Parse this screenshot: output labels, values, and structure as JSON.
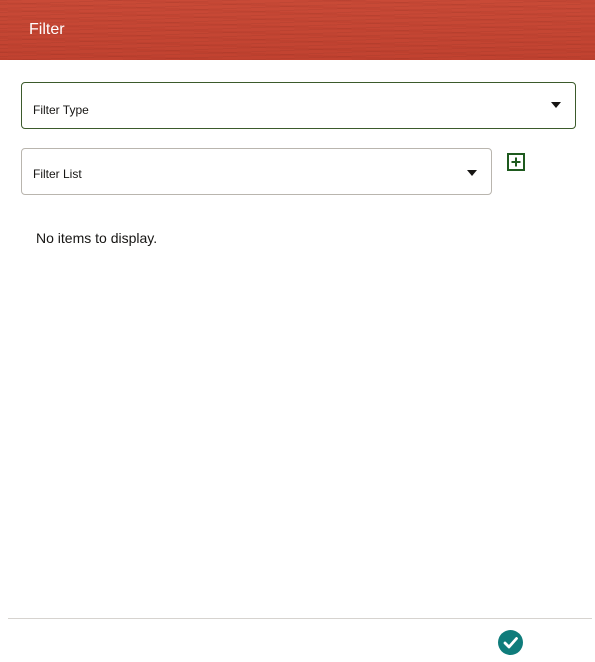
{
  "header": {
    "title": "Filter"
  },
  "form": {
    "filter_type": {
      "placeholder": "Filter Type",
      "icon": "chevron-down-icon"
    },
    "filter_list": {
      "placeholder": "Filter List",
      "icon": "chevron-down-icon"
    },
    "add_button": {
      "icon": "plus-square-icon"
    }
  },
  "content": {
    "empty_message": "No items to display."
  },
  "footer": {
    "confirm_button": {
      "icon": "checkmark-icon"
    }
  },
  "colors": {
    "header_background": "#c74634",
    "header_text": "#ffffff",
    "active_border": "#3b5a2b",
    "add_button_border": "#1e5a1e",
    "confirm_background": "#0f7c7b"
  }
}
